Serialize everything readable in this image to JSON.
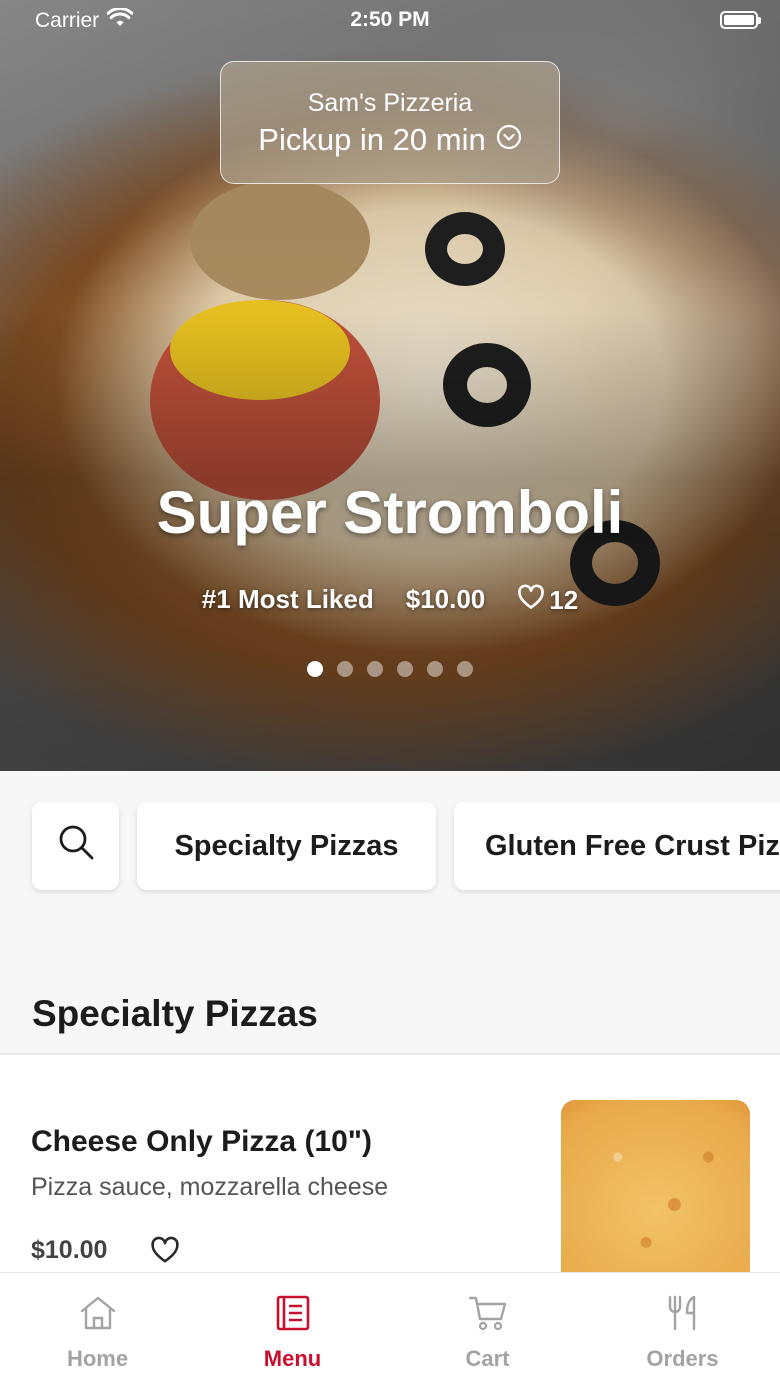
{
  "status_bar": {
    "carrier": "Carrier",
    "time": "2:50 PM"
  },
  "store": {
    "name": "Sam's Pizzeria",
    "pickup": "Pickup in 20 min"
  },
  "featured": {
    "title": "Super Stromboli",
    "rank": "#1 Most Liked",
    "price": "$10.00",
    "likes": "12",
    "slide_count": 6,
    "active_slide": 1
  },
  "categories": [
    "Specialty Pizzas",
    "Gluten Free Crust Pizzas"
  ],
  "section": {
    "title": "Specialty Pizzas",
    "items": [
      {
        "name": "Cheese Only Pizza (10\")",
        "description": "Pizza sauce, mozzarella cheese",
        "price": "$10.00"
      }
    ]
  },
  "tabs": [
    {
      "label": "Home",
      "icon": "home-icon",
      "active": false
    },
    {
      "label": "Menu",
      "icon": "menu-icon",
      "active": true
    },
    {
      "label": "Cart",
      "icon": "cart-icon",
      "active": false
    },
    {
      "label": "Orders",
      "icon": "utensils-icon",
      "active": false
    }
  ],
  "colors": {
    "accent": "#c8102e",
    "inactive": "#a3a3a3",
    "background": "#f7f7f7"
  }
}
